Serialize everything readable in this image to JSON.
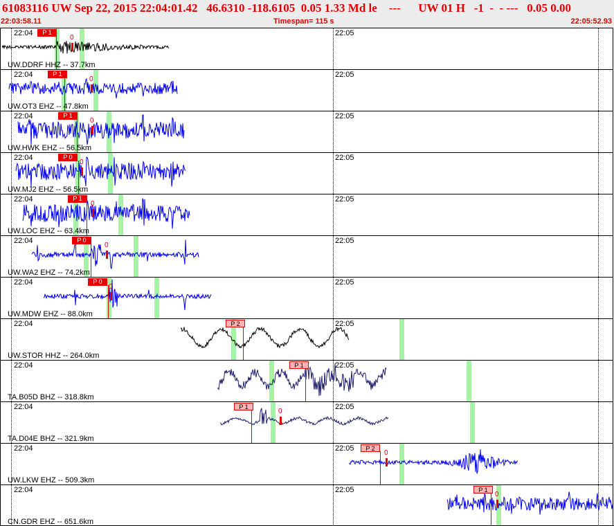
{
  "header": {
    "title": "61083116 UW Sep 22, 2015 22:04:01.42   46.6310 -118.6105  0.05 1.33 Md le    ---      UW 01 H   -1  -  - ---   0.05 0.00",
    "start_time": "22:03:58.11",
    "timespan": "Timespan= 115 s",
    "end_time": "22:05:52.93"
  },
  "time_ticks": [
    "22:04",
    "22:05"
  ],
  "colors": {
    "pick_red": "#e80000",
    "green_marker": "#a6f3a6",
    "header_text": "#e00000"
  },
  "channels": [
    {
      "label": "UW.DDRF HHZ -- 37.7km",
      "pick": "P 1",
      "pick_style": "solid",
      "origin": "0",
      "wave_color": "#000000"
    },
    {
      "label": "UW.OT3 EHZ -- 47.8km",
      "pick": "P 1",
      "pick_style": "solid",
      "origin": "0",
      "wave_color": "#0000ee"
    },
    {
      "label": "UW.HWK EHZ -- 56.5km",
      "pick": "P 1",
      "pick_style": "solid",
      "origin": "0",
      "wave_color": "#0000ee"
    },
    {
      "label": "UW.MJ2 EHZ -- 56.5km",
      "pick": "P 0",
      "pick_style": "solid",
      "origin": "0",
      "wave_color": "#0000ee"
    },
    {
      "label": "UW.LOC EHZ -- 63.4km",
      "pick": "P 1",
      "pick_style": "solid",
      "origin": "0",
      "wave_color": "#0000ee"
    },
    {
      "label": "UW.WA2 EHZ -- 74.2km",
      "pick": "P 0",
      "pick_style": "solid",
      "origin": "0",
      "wave_color": "#0000ee"
    },
    {
      "label": "UW.MDW EHZ -- 88.0km",
      "pick": "P 0",
      "pick_style": "solid",
      "origin": "0",
      "wave_color": "#0000ee"
    },
    {
      "label": "UW.STOR HHZ -- 264.0km",
      "pick": "P 2",
      "pick_style": "light",
      "origin": "",
      "wave_color": "#000000"
    },
    {
      "label": "TA.B05D BHZ -- 318.8km",
      "pick": "P 1",
      "pick_style": "light",
      "origin": "",
      "wave_color": "#1e1e6e"
    },
    {
      "label": "TA.D04E BHZ -- 321.9km",
      "pick": "P 1",
      "pick_style": "light",
      "origin": "0",
      "wave_color": "#1e1e6e"
    },
    {
      "label": "UW.LKW EHZ -- 509.3km",
      "pick": "P 2",
      "pick_style": "light",
      "origin": "0",
      "wave_color": "#0000ee"
    },
    {
      "label": "CN.GDR EHZ -- 651.6km",
      "pick": "P 1",
      "pick_style": "light",
      "origin": "0",
      "wave_color": "#0000ee"
    }
  ]
}
